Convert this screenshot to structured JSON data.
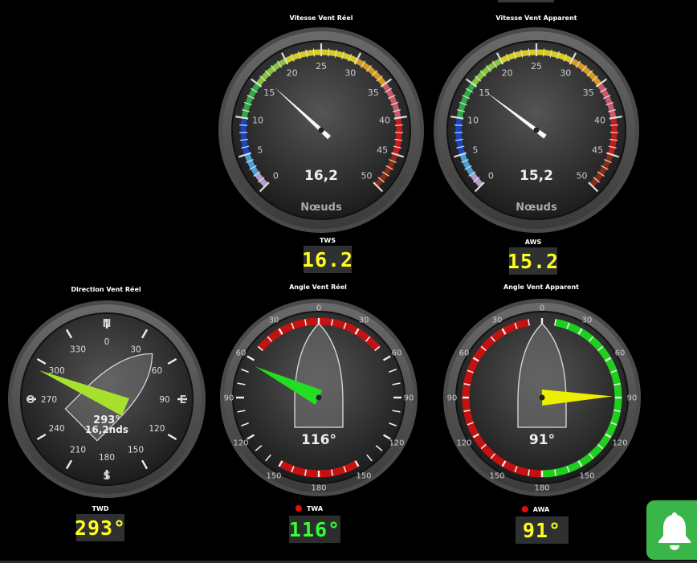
{
  "gauges": {
    "tws": {
      "title": "Vitesse Vent Réel",
      "value": "16,2",
      "unit": "Nœuds",
      "needle": 16.2,
      "ticks": [
        "0",
        "5",
        "10",
        "15",
        "20",
        "25",
        "30",
        "35",
        "40",
        "45",
        "50"
      ]
    },
    "aws": {
      "title": "Vitesse Vent Apparent",
      "value": "15,2",
      "unit": "Nœuds",
      "needle": 15.2,
      "ticks": [
        "0",
        "5",
        "10",
        "15",
        "20",
        "25",
        "30",
        "35",
        "40",
        "45",
        "50"
      ]
    },
    "twd": {
      "title": "Direction Vent Réel",
      "heading": "293°",
      "speed": "16,2nds",
      "needle": 293,
      "cardinals": [
        "N",
        "E",
        "S",
        "O"
      ],
      "ticks": [
        "0",
        "30",
        "60",
        "90",
        "120",
        "150",
        "180",
        "210",
        "240",
        "270",
        "300",
        "330"
      ]
    },
    "twa": {
      "title": "Angle Vent Réel",
      "value": "116°",
      "needle": 116,
      "ticks": [
        "0",
        "30",
        "60",
        "90",
        "120",
        "150",
        "180",
        "150",
        "120",
        "90",
        "60",
        "30"
      ]
    },
    "awa": {
      "title": "Angle Vent Apparent",
      "value": "91°",
      "needle": -91,
      "ticks": [
        "0",
        "30",
        "60",
        "90",
        "120",
        "150",
        "180",
        "150",
        "120",
        "90",
        "60",
        "30"
      ]
    }
  },
  "displays": {
    "tws": {
      "label": "TWS",
      "value": "16.2"
    },
    "aws": {
      "label": "AWS",
      "value": "15.2"
    },
    "twd": {
      "label": "TWD",
      "value": "293°"
    },
    "twa": {
      "label": "TWA",
      "value": "116°"
    },
    "awa": {
      "label": "AWA",
      "value": "91°"
    }
  },
  "colors": {
    "lcd_yellow": "#ffff20",
    "lcd_green": "#33ff33",
    "alarm_red": "#e01010",
    "needle_white": "#ffffff",
    "needle_green": "#22dd22",
    "needle_yellow": "#eeee00",
    "bell_green": "#39b54a"
  },
  "icons": {
    "alarm": "bell-icon",
    "status": "status-dot-icon"
  }
}
